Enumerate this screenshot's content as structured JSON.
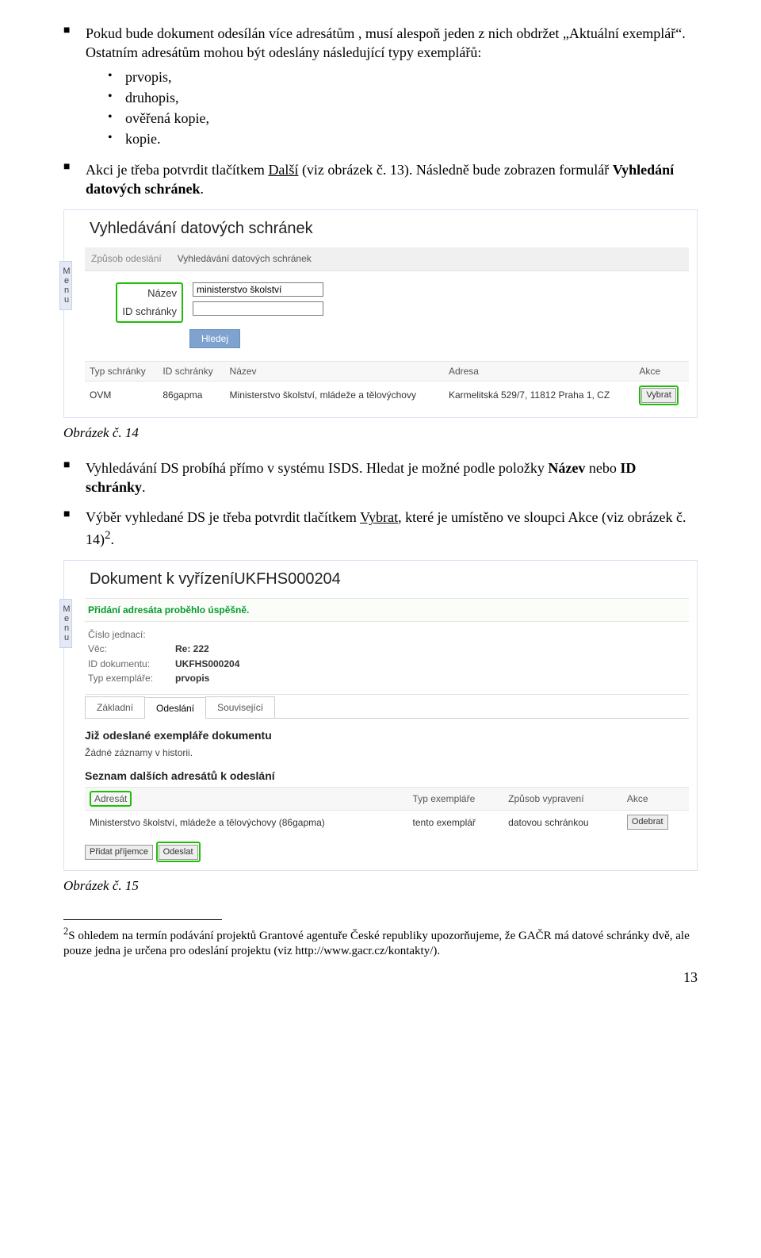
{
  "bullets": {
    "b1_a": "Pokud bude dokument odesílán více adresátům , musí alespoň jeden z nich obdržet „Aktuální exemplář“. Ostatním adresátům mohou být odeslány následující typy exemplářů:",
    "sub": [
      "prvopis,",
      "druhopis,",
      "ověřená kopie,",
      "kopie."
    ],
    "b2_pre": "Akci je třeba potvrdit tlačítkem ",
    "b2_link": "Další",
    "b2_post": " (viz obrázek č. 13). Následně bude zobrazen formulář ",
    "b2_bold": "Vyhledání datových schránek",
    "b2_end": ".",
    "b3_a": "Vyhledávání DS probíhá přímo v systému ISDS. Hledat je možné podle položky ",
    "b3_bold1": "Název",
    "b3_mid": " nebo ",
    "b3_bold2": "ID schránky",
    "b3_end": ".",
    "b4_a": "Výběr vyhledané DS je třeba potvrdit tlačítkem ",
    "b4_link": "Vybrat",
    "b4_b": ", které je umístěno ve sloupci Akce (viz obrázek č. 14)",
    "b4_sup": "2",
    "b4_end": "."
  },
  "caption14": "Obrázek č. 14",
  "caption15": "Obrázek č. 15",
  "shot1": {
    "menu": "Menu",
    "title": "Vyhledávání datových schránek",
    "crumb_label": "Způsob odeslání",
    "crumb_value": "Vyhledávání datových schránek",
    "label_nazev": "Název",
    "input_nazev": "ministerstvo školství",
    "label_id": "ID schránky",
    "btn_search": "Hledej",
    "cols": {
      "c1": "Typ schránky",
      "c2": "ID schránky",
      "c3": "Název",
      "c4": "Adresa",
      "c5": "Akce"
    },
    "row": {
      "c1": "OVM",
      "c2": "86gapma",
      "c3": "Ministerstvo školství, mládeže a tělovýchovy",
      "c4": "Karmelitská 529/7, 11812 Praha 1, CZ",
      "c5": "Vybrat"
    }
  },
  "shot2": {
    "menu": "Menu",
    "title": "Dokument k vyřízeníUKFHS000204",
    "success": "Přidání adresáta proběhlo úspěšně.",
    "meta": {
      "l1": "Číslo jednací:",
      "v1": "",
      "l2": "Věc:",
      "v2": "Re: 222",
      "l3": "ID dokumentu:",
      "v3": "UKFHS000204",
      "l4": "Typ exempláře:",
      "v4": "prvopis"
    },
    "tabs": {
      "t1": "Základní",
      "t2": "Odeslání",
      "t3": "Související"
    },
    "sect1": "Již odeslané exempláře dokumentu",
    "none": "Žádné záznamy v historii.",
    "sect2": "Seznam dalších adresátů k odeslání",
    "cols": {
      "c1": "Adresát",
      "c2": "Typ exempláře",
      "c3": "Způsob vypravení",
      "c4": "Akce"
    },
    "row": {
      "c1": "Ministerstvo školství, mládeže a tělovýchovy (86gapma)",
      "c2": "tento exemplář",
      "c3": "datovou schránkou",
      "c4": "Odebrat"
    },
    "btn_add": "Přidat příjemce",
    "btn_send": "Odeslat"
  },
  "footnote": {
    "sup": "2",
    "text": "S ohledem na termín podávání projektů Grantové agentuře České republiky upozorňujeme, že GAČR má datové schránky dvě, ale pouze jedna je určena pro odeslání projektu (viz http://www.gacr.cz/kontakty/)."
  },
  "pagenum": "13"
}
